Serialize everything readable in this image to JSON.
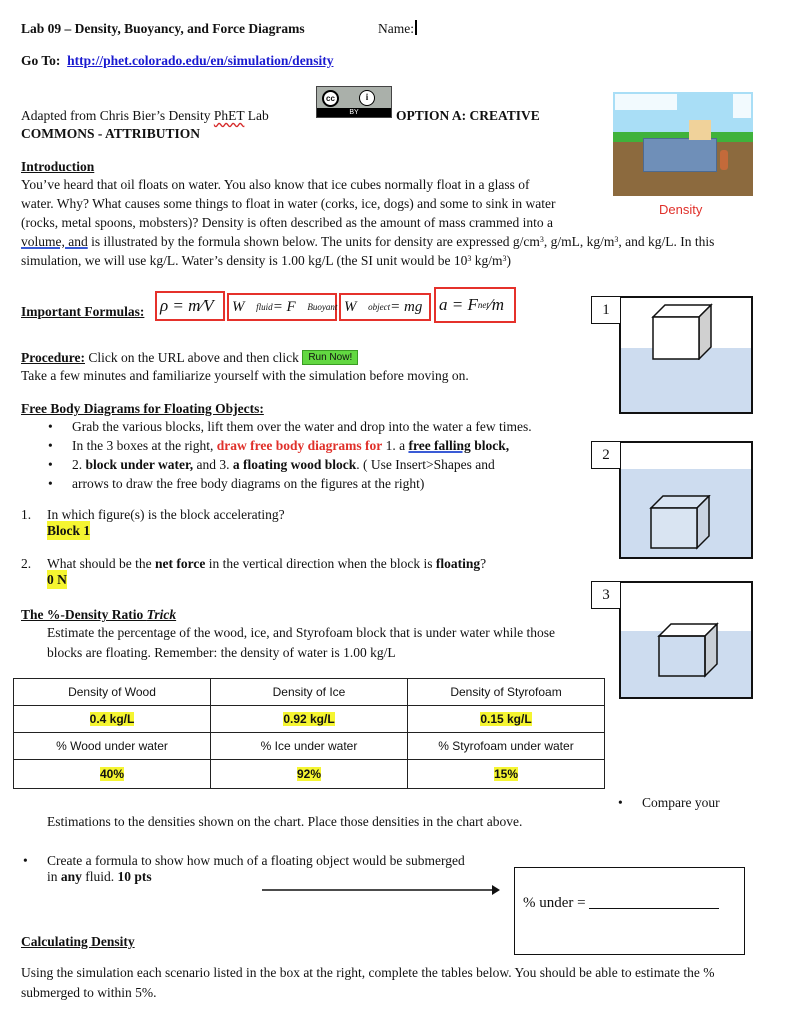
{
  "header": {
    "title": "Lab 09 – Density, Buoyancy, and Force Diagrams",
    "name_label": "Name:",
    "goto_label": "Go To:",
    "goto_url": "http://phet.colorado.edu/en/simulation/density"
  },
  "attribution": {
    "adapted_prefix": "Adapted from Chris Bier’s Density ",
    "phet": "PhET",
    "lab": " Lab",
    "cc_top": "cc",
    "cc_person": "i",
    "cc_by": "BY",
    "option_line1": "OPTION A: CREATIVE",
    "option_line2": "COMMONS - ATTRIBUTION"
  },
  "thumbnail": {
    "caption": "Density",
    "caption_color": "#e0302a"
  },
  "introduction": {
    "heading": "Introduction",
    "lines": [
      "You’ve heard that oil floats on water.  You also know that ice cubes normally float in a glass of",
      "water.  Why?  What causes some things to float in water (corks, ice, dogs) and some to sink in water",
      "(rocks, metal spoons, mobsters)?  Density is often described as the amount of mass crammed into a"
    ],
    "line4_link": "volume, and",
    "line4_rest_a": " is illustrated by the formula shown below.  The units for density are expressed g/cm",
    "line4_rest_b": ", g/mL, kg/m",
    "line4_rest_c": ", and kg/L.  In this",
    "line5_a": "simulation, we will use kg/L.  Water’s density is 1.00 kg/L (the SI unit would be 10",
    "line5_b": " kg/m",
    "line5_c": ")",
    "sup3": "3"
  },
  "formulas": {
    "label": "Important Formulas:",
    "f1": "ρ = m⁄V",
    "f2_a": "W⃗",
    "f2_sub1": "fluid",
    "f2_b": " = F⃗",
    "f2_sub2": "Buoyant",
    "f3_a": "W⃗",
    "f3_sub": "object",
    "f3_b": " = mg⃗",
    "f4_a": "a = F",
    "f4_sub": "net",
    "f4_b": "⁄m"
  },
  "procedure": {
    "label": "Procedure:",
    "text": " Click on the URL above and then click ",
    "button": "Run Now!",
    "line2": "Take a few minutes and familiarize yourself with the simulation before moving on."
  },
  "fbd": {
    "heading": "Free Body Diagrams for Floating Objects:",
    "b1": "Grab the various blocks, lift them over the water and drop into the water a few times.",
    "b2_a": "In the 3 boxes at the right, ",
    "b2_red": "draw free body diagrams for",
    "b2_b": " 1.  a ",
    "b2_link": "free falling",
    "b2_c": " block,",
    "b3_a": "2. ",
    "b3_b": "block under water,",
    "b3_c": " and 3.  ",
    "b3_d": "a floating wood block",
    "b3_e": ".  ( Use Insert>Shapes and",
    "b4": "arrows  to draw the free body diagrams on the figures at the right)"
  },
  "questions": [
    {
      "num": "1.",
      "text": "In which figure(s) is the block accelerating?",
      "answer": "Block 1"
    },
    {
      "num": "2.",
      "text_a": "What should be the ",
      "bold_a": "net force",
      "text_b": " in the vertical direction when the block is ",
      "bold_b": "floating",
      "text_c": "?",
      "answer": "0 N"
    }
  ],
  "figures": [
    {
      "num": "1",
      "state": "above water"
    },
    {
      "num": "2",
      "state": "under water"
    },
    {
      "num": "3",
      "state": "floating"
    }
  ],
  "trick": {
    "heading_a": "The %-Density Ratio ",
    "heading_b": "Trick",
    "line1": "Estimate the percentage of the wood, ice, and Styrofoam block that is under water while those",
    "line2": "blocks are floating.  Remember: the density of water is 1.00 kg/L"
  },
  "density_table": {
    "rows": [
      [
        "Density of Wood",
        "Density of Ice",
        "Density of Styrofoam"
      ],
      [
        "0.4 kg/L",
        "0.92 kg/L",
        "0.15 kg/L"
      ],
      [
        "% Wood under water",
        "% Ice under water",
        "% Styrofoam under water"
      ],
      [
        "40%",
        "92%",
        "15%"
      ]
    ]
  },
  "compare": {
    "bullet": "Compare your",
    "line": "Estimations to the densities shown on the chart.  Place those densities in the chart above."
  },
  "formula_task": {
    "line1": "Create a formula to show how much of a floating object would be submerged",
    "line2_a": "in ",
    "line2_b": "any",
    "line2_c": " fluid. ",
    "line2_d": "10 pts",
    "box_label": "% under = "
  },
  "calculating": {
    "heading": "Calculating Density",
    "line1": "Using the simulation each scenario listed in the box at the right, complete the tables below.  You should be able to estimate the %",
    "line2": "submerged to within 5%."
  }
}
